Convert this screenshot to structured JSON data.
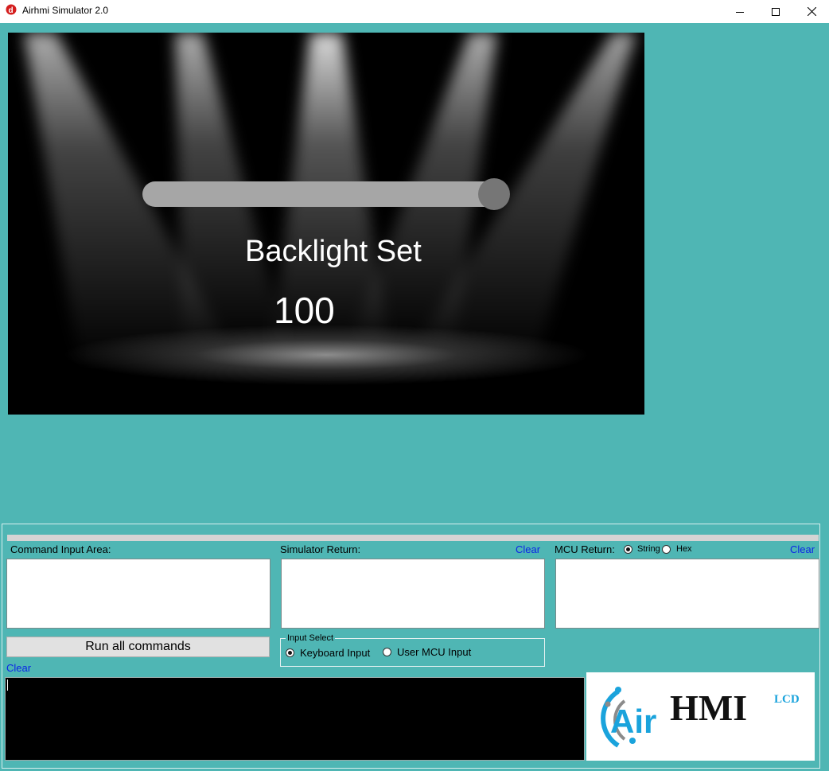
{
  "window": {
    "title": "Airhmi Simulator 2.0"
  },
  "screen": {
    "label": "Backlight Set",
    "value": "100",
    "slider_level": 1.0
  },
  "panel": {
    "command_input_label": "Command Input Area:",
    "simulator_return_label": "Simulator Return:",
    "simulator_clear": "Clear",
    "mcu_return_label": "MCU Return:",
    "mcu_format_options": [
      "String",
      "Hex"
    ],
    "mcu_format_selected": "String",
    "mcu_clear": "Clear",
    "run_button": "Run all commands",
    "command_clear": "Clear",
    "input_select": {
      "title": "Input Select",
      "options": [
        "Keyboard Input",
        "User MCU Input"
      ],
      "selected": "Keyboard Input"
    }
  },
  "logo": {
    "brand_air": "Air",
    "brand_hmi": "HMI",
    "brand_lcd": "LCD"
  },
  "colors": {
    "background": "#4fb6b4",
    "link": "#0c24e6",
    "slider_track": "#a6a6a6",
    "slider_knob": "#767676",
    "logo_blue": "#1aa3dc"
  }
}
